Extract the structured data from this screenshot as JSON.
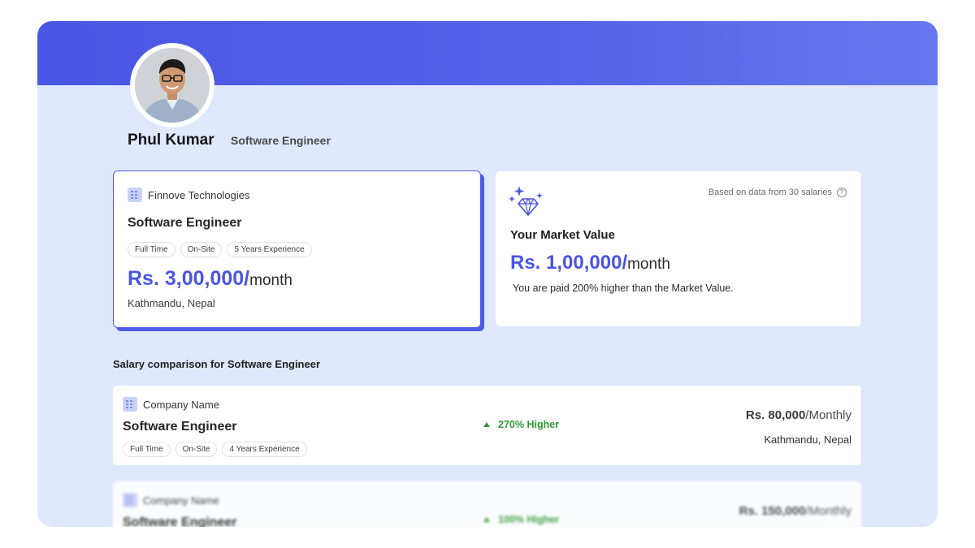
{
  "profile": {
    "name": "Phul Kumar",
    "role": "Software Engineer"
  },
  "current_job": {
    "company": "Finnove Technologies",
    "title": "Software Engineer",
    "tags": [
      "Full Time",
      "On-Site",
      "5 Years Experience"
    ],
    "salary_amount": "Rs. 3,00,000/",
    "salary_period": "month",
    "location": "Kathmandu, Nepal"
  },
  "market": {
    "based_on": "Based on data from 30 salaries",
    "help_icon": "?",
    "title": "Your Market Value",
    "salary_amount": "Rs. 1,00,000/",
    "salary_period": "month",
    "note": "You are paid 200% higher than the Market Value."
  },
  "comparison": {
    "heading": "Salary comparison for Software Engineer",
    "rows": [
      {
        "company": "Company Name",
        "title": "Software Engineer",
        "tags": [
          "Full Time",
          "On-Site",
          "4 Years Experience"
        ],
        "diff": "270% Higher",
        "salary_amount": "Rs. 80,000",
        "salary_period": "/Monthly",
        "location": "Kathmandu, Nepal"
      },
      {
        "company": "Company Name",
        "title": "Software Engineer",
        "diff": "100% Higher",
        "salary_amount": "Rs. 150,000",
        "salary_period": "/Monthly"
      }
    ]
  },
  "colors": {
    "accent": "#4a55e0",
    "banner": "#4f5be6",
    "background": "#e0e8fd",
    "positive": "#2e9a2e"
  },
  "icons": [
    "building-icon",
    "diamond-icon",
    "help-icon",
    "arrow-up-icon",
    "avatar"
  ]
}
